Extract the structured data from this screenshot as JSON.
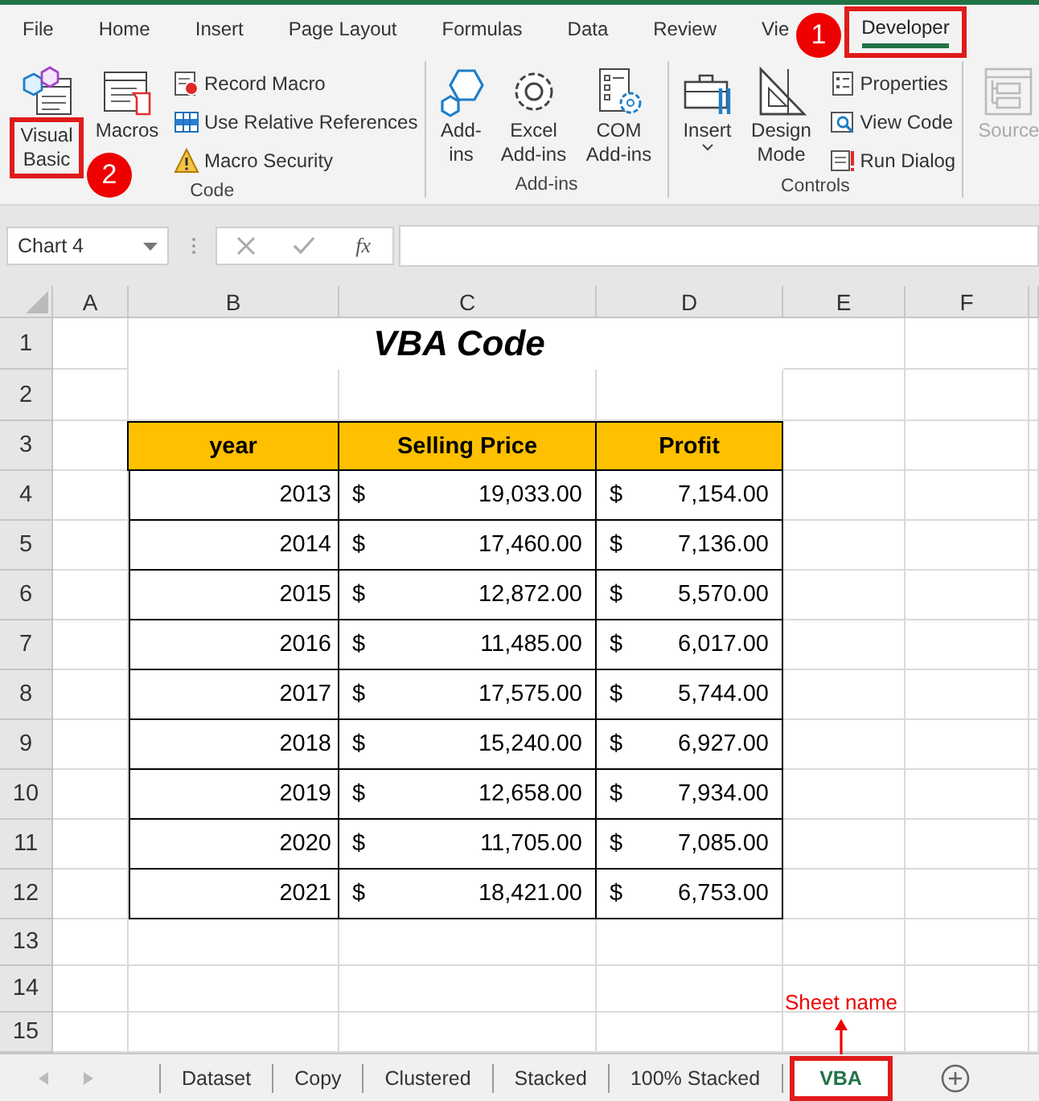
{
  "ribbon_tabs": [
    {
      "label": "File",
      "selected": false,
      "highlighted": false
    },
    {
      "label": "Home",
      "selected": false,
      "highlighted": false
    },
    {
      "label": "Insert",
      "selected": false,
      "highlighted": false
    },
    {
      "label": "Page Layout",
      "selected": false,
      "highlighted": false
    },
    {
      "label": "Formulas",
      "selected": false,
      "highlighted": false
    },
    {
      "label": "Data",
      "selected": false,
      "highlighted": false
    },
    {
      "label": "Review",
      "selected": false,
      "highlighted": false
    },
    {
      "label": "Vie",
      "selected": false,
      "highlighted": false
    },
    {
      "label": "Developer",
      "selected": true,
      "highlighted": true
    }
  ],
  "ribbon_groups": [
    {
      "label": "Code",
      "items": [
        {
          "kind": "vb",
          "label": "Visual Basic",
          "highlighted": true,
          "disabled": false
        },
        {
          "kind": "macros",
          "label": "Macros",
          "highlighted": false,
          "disabled": false
        },
        {
          "kind": "stack",
          "items": [
            {
              "kind": "record",
              "label": "Record Macro"
            },
            {
              "kind": "relative",
              "label": "Use Relative References"
            },
            {
              "kind": "security",
              "label": "Macro Security"
            }
          ]
        }
      ]
    },
    {
      "label": "Add-ins",
      "items": [
        {
          "kind": "addins",
          "label": "Add-ins",
          "highlighted": false,
          "disabled": false
        },
        {
          "kind": "excel-addins",
          "label": "Excel Add-ins",
          "highlighted": false,
          "disabled": false
        },
        {
          "kind": "com-addins",
          "label": "COM Add-ins",
          "highlighted": false,
          "disabled": false
        }
      ]
    },
    {
      "label": "Controls",
      "items": [
        {
          "kind": "insert",
          "label": "Insert",
          "caret": true,
          "highlighted": false,
          "disabled": false
        },
        {
          "kind": "design",
          "label": "Design Mode",
          "highlighted": false,
          "disabled": false
        },
        {
          "kind": "stack",
          "items": [
            {
              "kind": "properties",
              "label": "Properties"
            },
            {
              "kind": "viewcode",
              "label": "View Code"
            },
            {
              "kind": "rundialog",
              "label": "Run Dialog"
            }
          ]
        }
      ]
    },
    {
      "items": [
        {
          "kind": "source",
          "label": "Source",
          "highlighted": false,
          "disabled": true
        }
      ]
    }
  ],
  "formula_bar": {
    "name_box": "Chart 4",
    "function_label": "fx"
  },
  "columns": [
    "A",
    "B",
    "C",
    "D",
    "E",
    "F"
  ],
  "rows": [
    "1",
    "2",
    "3",
    "4",
    "5",
    "6",
    "7",
    "8",
    "9",
    "10",
    "11",
    "12",
    "13",
    "14",
    "15"
  ],
  "title": "VBA Code",
  "table": {
    "columns": [
      "year",
      "Selling Price",
      "Profit"
    ],
    "rows": [
      {
        "year": "2013",
        "selling_price": {
          "symbol": "$",
          "amount": "19,033.00"
        },
        "profit": {
          "symbol": "$",
          "amount": "7,154.00"
        }
      },
      {
        "year": "2014",
        "selling_price": {
          "symbol": "$",
          "amount": "17,460.00"
        },
        "profit": {
          "symbol": "$",
          "amount": "7,136.00"
        }
      },
      {
        "year": "2015",
        "selling_price": {
          "symbol": "$",
          "amount": "12,872.00"
        },
        "profit": {
          "symbol": "$",
          "amount": "5,570.00"
        }
      },
      {
        "year": "2016",
        "selling_price": {
          "symbol": "$",
          "amount": "11,485.00"
        },
        "profit": {
          "symbol": "$",
          "amount": "6,017.00"
        }
      },
      {
        "year": "2017",
        "selling_price": {
          "symbol": "$",
          "amount": "17,575.00"
        },
        "profit": {
          "symbol": "$",
          "amount": "5,744.00"
        }
      },
      {
        "year": "2018",
        "selling_price": {
          "symbol": "$",
          "amount": "15,240.00"
        },
        "profit": {
          "symbol": "$",
          "amount": "6,927.00"
        }
      },
      {
        "year": "2019",
        "selling_price": {
          "symbol": "$",
          "amount": "12,658.00"
        },
        "profit": {
          "symbol": "$",
          "amount": "7,934.00"
        }
      },
      {
        "year": "2020",
        "selling_price": {
          "symbol": "$",
          "amount": "11,705.00"
        },
        "profit": {
          "symbol": "$",
          "amount": "7,085.00"
        }
      },
      {
        "year": "2021",
        "selling_price": {
          "symbol": "$",
          "amount": "18,421.00"
        },
        "profit": {
          "symbol": "$",
          "amount": "6,753.00"
        }
      }
    ]
  },
  "sheet_tabs": [
    {
      "label": "Dataset",
      "selected": false,
      "highlighted": false
    },
    {
      "label": "Copy",
      "selected": false,
      "highlighted": false
    },
    {
      "label": "Clustered",
      "selected": false,
      "highlighted": false
    },
    {
      "label": "Stacked",
      "selected": false,
      "highlighted": false
    },
    {
      "label": "100% Stacked",
      "selected": false,
      "highlighted": false
    },
    {
      "label": "VBA",
      "selected": true,
      "highlighted": true
    }
  ],
  "annotations": [
    {
      "kind": "badge",
      "text": "1"
    },
    {
      "kind": "badge",
      "text": "2"
    },
    {
      "kind": "callout",
      "text": "Sheet name"
    }
  ]
}
